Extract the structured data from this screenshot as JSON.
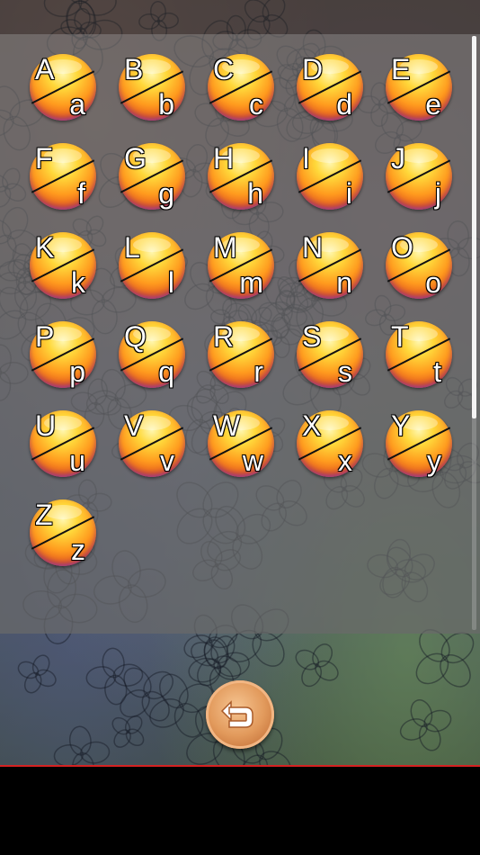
{
  "screen": "alphabet-select",
  "colors": {
    "ball_top": "#ffd83a",
    "ball_rim": "#b04ad0",
    "divider": "#d42222",
    "back_button": "#e29a5c"
  },
  "letters": [
    {
      "upper": "A",
      "lower": "a"
    },
    {
      "upper": "B",
      "lower": "b"
    },
    {
      "upper": "C",
      "lower": "c"
    },
    {
      "upper": "D",
      "lower": "d"
    },
    {
      "upper": "E",
      "lower": "e"
    },
    {
      "upper": "F",
      "lower": "f"
    },
    {
      "upper": "G",
      "lower": "g"
    },
    {
      "upper": "H",
      "lower": "h"
    },
    {
      "upper": "I",
      "lower": "i"
    },
    {
      "upper": "J",
      "lower": "j"
    },
    {
      "upper": "K",
      "lower": "k"
    },
    {
      "upper": "L",
      "lower": "l"
    },
    {
      "upper": "M",
      "lower": "m"
    },
    {
      "upper": "N",
      "lower": "n"
    },
    {
      "upper": "O",
      "lower": "o"
    },
    {
      "upper": "P",
      "lower": "p"
    },
    {
      "upper": "Q",
      "lower": "q"
    },
    {
      "upper": "R",
      "lower": "r"
    },
    {
      "upper": "S",
      "lower": "s"
    },
    {
      "upper": "T",
      "lower": "t"
    },
    {
      "upper": "U",
      "lower": "u"
    },
    {
      "upper": "V",
      "lower": "v"
    },
    {
      "upper": "W",
      "lower": "w"
    },
    {
      "upper": "X",
      "lower": "x"
    },
    {
      "upper": "Y",
      "lower": "y"
    },
    {
      "upper": "Z",
      "lower": "z"
    }
  ],
  "back_button": {
    "icon": "return-arrow-icon"
  },
  "scroll": {
    "position_fraction": 0.0,
    "visible_fraction": 0.64
  }
}
